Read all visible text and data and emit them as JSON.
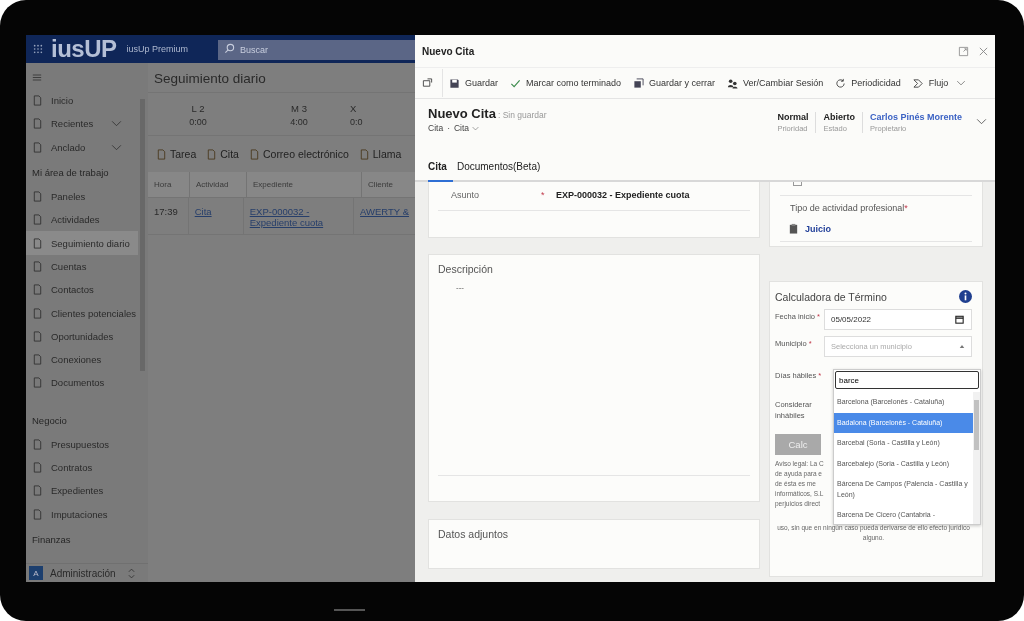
{
  "app": {
    "logo": "iusUP",
    "product": "iusUp Premium",
    "search": {
      "placeholder": "Buscar"
    }
  },
  "sidebar": {
    "groups": [
      {
        "items": [
          {
            "label": "Inicio",
            "expandable": false,
            "selected": false
          },
          {
            "label": "Recientes",
            "expandable": true,
            "selected": false
          },
          {
            "label": "Anclado",
            "expandable": true,
            "selected": false
          }
        ]
      },
      {
        "title": "Mi área de trabajo",
        "items": [
          {
            "label": "Paneles",
            "expandable": false,
            "selected": false
          },
          {
            "label": "Actividades",
            "expandable": false,
            "selected": false
          },
          {
            "label": "Seguimiento diario",
            "expandable": false,
            "selected": true
          },
          {
            "label": "Cuentas",
            "expandable": false,
            "selected": false
          },
          {
            "label": "Contactos",
            "expandable": false,
            "selected": false
          },
          {
            "label": "Clientes potenciales",
            "expandable": false,
            "selected": false
          },
          {
            "label": "Oportunidades",
            "expandable": false,
            "selected": false
          },
          {
            "label": "Conexiones",
            "expandable": false,
            "selected": false
          },
          {
            "label": "Documentos",
            "expandable": false,
            "selected": false
          }
        ]
      },
      {
        "title": "Negocio",
        "items": [
          {
            "label": "Presupuestos",
            "expandable": false,
            "selected": false
          },
          {
            "label": "Contratos",
            "expandable": false,
            "selected": false
          },
          {
            "label": "Expedientes",
            "expandable": false,
            "selected": false
          },
          {
            "label": "Imputaciones",
            "expandable": false,
            "selected": false
          }
        ]
      },
      {
        "title": "Finanzas"
      }
    ],
    "area": {
      "initial": "A",
      "label": "Administración"
    }
  },
  "page": {
    "title": "Seguimiento diario",
    "days": [
      {
        "day": "L 2",
        "hours": "0:00"
      },
      {
        "day": "M 3",
        "hours": "4:00"
      },
      {
        "day": "X",
        "hours": "0:0"
      }
    ],
    "commands": [
      "Tarea",
      "Cita",
      "Correo electrónico",
      "Llama"
    ],
    "table": {
      "columns": [
        "Hora",
        "Actividad",
        "Expediente",
        "Cliente"
      ],
      "rows": [
        {
          "cells": [
            {
              "text": "17:39",
              "kind": "text"
            },
            {
              "text": "Cita",
              "kind": "link"
            },
            {
              "text": "EXP-000032 - Expediente cuota",
              "kind": "link"
            },
            {
              "text": "AWERTY &",
              "kind": "link"
            }
          ]
        }
      ]
    }
  },
  "panel": {
    "title": "Nuevo Cita",
    "toolbar": [
      "Guardar",
      "Marcar como terminado",
      "Guardar y cerrar",
      "Ver/Cambiar Sesión",
      "Periodicidad",
      "Flujo"
    ],
    "record": {
      "title": "Nuevo Cita",
      "status": ": Sin guardar",
      "breadcrumb": [
        "Cita",
        "Cita"
      ],
      "separator": "·"
    },
    "header_fields": [
      {
        "value": "Normal",
        "label": "Prioridad",
        "kind": "text"
      },
      {
        "value": "Abierto",
        "label": "Estado",
        "kind": "text"
      },
      {
        "value": "Carlos Pinés Morente",
        "label": "Propietario",
        "kind": "link"
      }
    ],
    "tabs": [
      {
        "label": "Cita",
        "selected": true
      },
      {
        "label": "Documentos(Beta)",
        "selected": false
      }
    ],
    "asunto": {
      "label": "Asunto",
      "required_mark": "*",
      "value": "EXP-000032 - Expediente cuota"
    },
    "descripcion": {
      "title": "Descripción",
      "value": "---"
    },
    "adjuntos": {
      "title": "Datos adjuntos"
    },
    "checkbox": {
      "checked": false
    },
    "tipo_actividad": {
      "label": "Tipo de actividad profesional",
      "required_mark": "*",
      "value": "Juicio"
    },
    "calculadora": {
      "title": "Calculadora de Término",
      "fecha_inicio": {
        "label": "Fecha inicio",
        "required_mark": "*",
        "value": "05/05/2022"
      },
      "municipio": {
        "label": "Municipio",
        "required_mark": "*",
        "placeholder": "Selecciona un municipio"
      },
      "dias_habiles": {
        "label": "Días hábiles",
        "required_mark": "*"
      },
      "considerar": {
        "label": "Considerar inhábiles"
      },
      "button": "Calc",
      "legal_fragments": [
        "Aviso legal: La C",
        "de ayuda para e",
        "de ésta es me",
        "informáticos, S.L",
        "perjuicios direct"
      ],
      "legal_tail": [
        "uso, sin que en ningún caso pueda derivarse de ello efecto jurídico",
        "alguno."
      ],
      "dropdown": {
        "search": "barce",
        "options": [
          {
            "label": "Barcelona (Barcelonès - Cataluña)",
            "selected": false
          },
          {
            "label": "Badalona (Barcelonès - Cataluña)",
            "selected": true
          },
          {
            "label": "Barcebal (Soria - Castilla y León)",
            "selected": false
          },
          {
            "label": "Barcebalejo (Soria - Castilla y León)",
            "selected": false
          },
          {
            "label": "Bárcena De Campos (Palencia - Castilla y León)",
            "selected": false
          },
          {
            "label": "Barcena De Cicero (Cantabria -",
            "selected": false
          }
        ]
      }
    }
  }
}
